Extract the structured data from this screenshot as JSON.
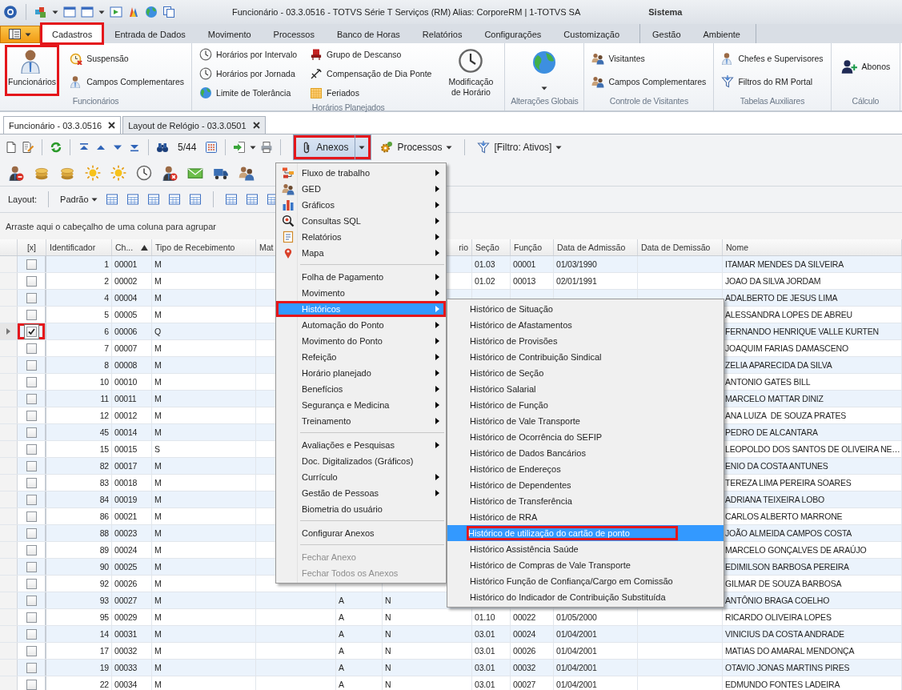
{
  "title_bar": {
    "title": "Funcionário - 03.3.0516 - TOTVS Série T Serviços (RM) Alias: CorporeRM | 1-TOTVS SA",
    "context": "Sistema"
  },
  "ribbon_tabs": [
    {
      "label": "Cadastros",
      "selected": true,
      "highlighted": true
    },
    {
      "label": "Entrada de Dados",
      "selected": false,
      "highlighted": false
    },
    {
      "label": "Movimento",
      "selected": false,
      "highlighted": false
    },
    {
      "label": "Processos",
      "selected": false,
      "highlighted": false
    },
    {
      "label": "Banco de Horas",
      "selected": false,
      "highlighted": false
    },
    {
      "label": "Relatórios",
      "selected": false,
      "highlighted": false
    },
    {
      "label": "Configurações",
      "selected": false,
      "highlighted": false
    },
    {
      "label": "Customização",
      "selected": false,
      "highlighted": false
    }
  ],
  "contextual_tabs": [
    {
      "label": "Gestão",
      "selected": false,
      "highlighted": false
    },
    {
      "label": "Ambiente",
      "selected": false,
      "highlighted": false
    }
  ],
  "ribbon_groups": [
    {
      "label": "Funcionários",
      "items": [
        {
          "kind": "large",
          "label": "Funcionários",
          "highlighted": true
        },
        {
          "kind": "small",
          "label": "Suspensão",
          "highlighted": false
        },
        {
          "kind": "small",
          "label": "Campos Complementares",
          "highlighted": false
        }
      ]
    },
    {
      "label": "Horários Planejados",
      "items": [
        {
          "kind": "small",
          "label": "Horários por Intervalo",
          "highlighted": false
        },
        {
          "kind": "small",
          "label": "Horários por Jornada",
          "highlighted": false
        },
        {
          "kind": "small",
          "label": "Limite de Tolerância",
          "highlighted": false
        },
        {
          "kind": "small",
          "label": "Grupo de Descanso",
          "highlighted": false
        },
        {
          "kind": "small",
          "label": "Compensação de Dia Ponte",
          "highlighted": false
        },
        {
          "kind": "small",
          "label": "Feriados",
          "highlighted": false
        },
        {
          "kind": "large",
          "label": "Modificação de Horário",
          "highlighted": false
        }
      ]
    },
    {
      "label": "Alterações Globais",
      "items": [
        {
          "kind": "dropdown",
          "highlighted": false
        }
      ]
    },
    {
      "label": "Controle de Visitantes",
      "items": [
        {
          "kind": "small",
          "label": "Visitantes",
          "highlighted": false
        },
        {
          "kind": "small",
          "label": "Campos Complementares",
          "highlighted": false
        }
      ]
    },
    {
      "label": "Tabelas Auxiliares",
      "items": [
        {
          "kind": "small",
          "label": "Chefes e Supervisores",
          "highlighted": false
        },
        {
          "kind": "small",
          "label": "Filtros do RM Portal",
          "highlighted": false
        }
      ]
    },
    {
      "label": "Cálculo",
      "items": [
        {
          "kind": "medium",
          "label": "Abonos",
          "highlighted": false
        }
      ]
    }
  ],
  "document_tabs": [
    {
      "label": "Funcionário - 03.3.0516",
      "selected": true
    },
    {
      "label": "Layout de Relógio - 03.3.0501",
      "selected": false
    }
  ],
  "toolbar": {
    "record_position": "5/44",
    "anexos": {
      "label": "Anexos",
      "highlighted": true,
      "expanded": true
    },
    "processos": {
      "label": "Processos"
    },
    "filter": {
      "label": "[Filtro: Ativos]"
    }
  },
  "layout_bar": {
    "label": "Layout:",
    "layout": "Padrão"
  },
  "group_panel": {
    "hint": "Arraste aqui o cabeçalho de uma coluna para agrupar"
  },
  "grid": {
    "check_header": "[x]",
    "columns": [
      {
        "label": "Identificador",
        "kind": "number"
      },
      {
        "label": "Ch...",
        "kind": "text",
        "sorted_ascending": true
      },
      {
        "label": "Tipo de Recebimento",
        "kind": "text"
      },
      {
        "label": "Mat",
        "kind": "text"
      },
      {
        "kind": "text"
      },
      {
        "label": "rio",
        "kind": "cut"
      },
      {
        "label": "Seção",
        "kind": "text"
      },
      {
        "label": "Função",
        "kind": "text"
      },
      {
        "label": "Data de Admissão",
        "kind": "text"
      },
      {
        "label": "Data de Demissão",
        "kind": "text"
      },
      {
        "label": "Nome",
        "kind": "text"
      }
    ],
    "rows": [
      {
        "checked": false,
        "current": false,
        "checkbox_highlighted": false,
        "cells": [
          "1",
          "00001",
          "M",
          null,
          null,
          null,
          "01.03",
          "00001",
          "01/03/1990",
          null,
          "ITAMAR MENDES DA SILVEIRA"
        ]
      },
      {
        "checked": false,
        "current": false,
        "checkbox_highlighted": false,
        "cells": [
          "2",
          "00002",
          "M",
          null,
          null,
          null,
          "01.02",
          "00013",
          "02/01/1991",
          null,
          "JOAO DA SILVA JORDAM"
        ]
      },
      {
        "checked": false,
        "current": false,
        "checkbox_highlighted": false,
        "cells": [
          "4",
          "00004",
          "M",
          null,
          null,
          null,
          null,
          null,
          null,
          null,
          "ADALBERTO DE JESUS LIMA"
        ]
      },
      {
        "checked": false,
        "current": false,
        "checkbox_highlighted": false,
        "cells": [
          "5",
          "00005",
          "M",
          null,
          null,
          null,
          null,
          null,
          null,
          null,
          "ALESSANDRA LOPES DE ABREU"
        ]
      },
      {
        "checked": true,
        "current": true,
        "checkbox_highlighted": true,
        "cells": [
          "6",
          "00006",
          "Q",
          null,
          null,
          null,
          null,
          null,
          null,
          null,
          "FERNANDO HENRIQUE VALLE KURTEN"
        ]
      },
      {
        "checked": false,
        "current": false,
        "checkbox_highlighted": false,
        "cells": [
          "7",
          "00007",
          "M",
          null,
          null,
          null,
          null,
          null,
          null,
          null,
          "JOAQUIM FARIAS DAMASCENO"
        ]
      },
      {
        "checked": false,
        "current": false,
        "checkbox_highlighted": false,
        "cells": [
          "8",
          "00008",
          "M",
          null,
          null,
          null,
          null,
          null,
          null,
          null,
          "ZELIA APARECIDA DA SILVA"
        ]
      },
      {
        "checked": false,
        "current": false,
        "checkbox_highlighted": false,
        "cells": [
          "10",
          "00010",
          "M",
          null,
          null,
          null,
          null,
          null,
          null,
          null,
          "ANTONIO GATES BILL"
        ]
      },
      {
        "checked": false,
        "current": false,
        "checkbox_highlighted": false,
        "cells": [
          "11",
          "00011",
          "M",
          null,
          null,
          null,
          null,
          null,
          null,
          null,
          "MARCELO MATTAR DINIZ"
        ]
      },
      {
        "checked": false,
        "current": false,
        "checkbox_highlighted": false,
        "cells": [
          "12",
          "00012",
          "M",
          null,
          null,
          null,
          null,
          null,
          null,
          null,
          "ANA LUIZA  DE SOUZA PRATES"
        ]
      },
      {
        "checked": false,
        "current": false,
        "checkbox_highlighted": false,
        "cells": [
          "45",
          "00014",
          "M",
          null,
          null,
          null,
          null,
          null,
          null,
          null,
          "PEDRO DE ALCANTARA"
        ]
      },
      {
        "checked": false,
        "current": false,
        "checkbox_highlighted": false,
        "cells": [
          "15",
          "00015",
          "S",
          null,
          null,
          null,
          null,
          null,
          null,
          null,
          "LEOPOLDO DOS SANTOS DE OLIVEIRA NE…"
        ]
      },
      {
        "checked": false,
        "current": false,
        "checkbox_highlighted": false,
        "cells": [
          "82",
          "00017",
          "M",
          null,
          null,
          null,
          null,
          null,
          null,
          null,
          "ENIO DA COSTA ANTUNES"
        ]
      },
      {
        "checked": false,
        "current": false,
        "checkbox_highlighted": false,
        "cells": [
          "83",
          "00018",
          "M",
          null,
          null,
          null,
          null,
          null,
          null,
          null,
          "TEREZA LIMA PEREIRA SOARES"
        ]
      },
      {
        "checked": false,
        "current": false,
        "checkbox_highlighted": false,
        "cells": [
          "84",
          "00019",
          "M",
          null,
          null,
          null,
          null,
          null,
          null,
          null,
          "ADRIANA TEIXEIRA LOBO"
        ]
      },
      {
        "checked": false,
        "current": false,
        "checkbox_highlighted": false,
        "cells": [
          "86",
          "00021",
          "M",
          null,
          null,
          null,
          null,
          null,
          null,
          null,
          "CARLOS ALBERTO MARRONE"
        ]
      },
      {
        "checked": false,
        "current": false,
        "checkbox_highlighted": false,
        "cells": [
          "88",
          "00023",
          "M",
          null,
          null,
          null,
          null,
          null,
          null,
          null,
          "JOÃO ALMEIDA CAMPOS COSTA"
        ]
      },
      {
        "checked": false,
        "current": false,
        "checkbox_highlighted": false,
        "cells": [
          "89",
          "00024",
          "M",
          null,
          null,
          null,
          null,
          null,
          null,
          null,
          "MARCELO GONÇALVES DE ARAÚJO"
        ]
      },
      {
        "checked": false,
        "current": false,
        "checkbox_highlighted": false,
        "cells": [
          "90",
          "00025",
          "M",
          null,
          null,
          null,
          null,
          null,
          null,
          null,
          "EDIMILSON BARBOSA PEREIRA"
        ]
      },
      {
        "checked": false,
        "current": false,
        "checkbox_highlighted": false,
        "cells": [
          "92",
          "00026",
          "M",
          null,
          null,
          null,
          null,
          null,
          null,
          null,
          "GILMAR DE SOUZA BARBOSA"
        ]
      },
      {
        "checked": false,
        "current": false,
        "checkbox_highlighted": false,
        "cells": [
          "93",
          "00027",
          "M",
          null,
          "A",
          "N",
          null,
          null,
          null,
          null,
          "ANTÔNIO BRAGA COELHO"
        ]
      },
      {
        "checked": false,
        "current": false,
        "checkbox_highlighted": false,
        "cells": [
          "95",
          "00029",
          "M",
          null,
          "A",
          "N",
          "01.10",
          "00022",
          "01/05/2000",
          null,
          "RICARDO OLIVEIRA LOPES"
        ]
      },
      {
        "checked": false,
        "current": false,
        "checkbox_highlighted": false,
        "cells": [
          "14",
          "00031",
          "M",
          null,
          "A",
          "N",
          "03.01",
          "00024",
          "01/04/2001",
          null,
          "VINICIUS DA COSTA ANDRADE"
        ]
      },
      {
        "checked": false,
        "current": false,
        "checkbox_highlighted": false,
        "cells": [
          "17",
          "00032",
          "M",
          null,
          "A",
          "N",
          "03.01",
          "00026",
          "01/04/2001",
          null,
          "MATIAS DO AMARAL MENDONÇA"
        ]
      },
      {
        "checked": false,
        "current": false,
        "checkbox_highlighted": false,
        "cells": [
          "19",
          "00033",
          "M",
          null,
          "A",
          "N",
          "03.01",
          "00032",
          "01/04/2001",
          null,
          "OTAVIO JONAS MARTINS PIRES"
        ]
      },
      {
        "checked": false,
        "current": false,
        "checkbox_highlighted": false,
        "cells": [
          "22",
          "00034",
          "M",
          null,
          "A",
          "N",
          "03.01",
          "00027",
          "01/04/2001",
          null,
          "EDMUNDO FONTES LADEIRA"
        ]
      }
    ]
  },
  "anexos_menu": {
    "groups": [
      [
        {
          "label": "Fluxo de trabalho",
          "submenu": true,
          "selected": false,
          "highlighted": false,
          "disabled": false
        },
        {
          "label": "GED",
          "submenu": true,
          "selected": false,
          "highlighted": false,
          "disabled": false
        },
        {
          "label": "Gráficos",
          "submenu": true,
          "selected": false,
          "highlighted": false,
          "disabled": false
        },
        {
          "label": "Consultas SQL",
          "submenu": true,
          "selected": false,
          "highlighted": false,
          "disabled": false
        },
        {
          "label": "Relatórios",
          "submenu": true,
          "selected": false,
          "highlighted": false,
          "disabled": false
        },
        {
          "label": "Mapa",
          "submenu": true,
          "selected": false,
          "highlighted": false,
          "disabled": false
        }
      ],
      [
        {
          "label": "Folha de Pagamento",
          "submenu": true,
          "selected": false,
          "highlighted": false,
          "disabled": false
        },
        {
          "label": "Movimento",
          "submenu": true,
          "selected": false,
          "highlighted": false,
          "disabled": false
        },
        {
          "label": "Históricos",
          "submenu": true,
          "selected": true,
          "highlighted": true,
          "disabled": false
        },
        {
          "label": "Automação do Ponto",
          "submenu": true,
          "selected": false,
          "highlighted": false,
          "disabled": false
        },
        {
          "label": "Movimento do Ponto",
          "submenu": true,
          "selected": false,
          "highlighted": false,
          "disabled": false
        },
        {
          "label": "Refeição",
          "submenu": true,
          "selected": false,
          "highlighted": false,
          "disabled": false
        },
        {
          "label": "Horário planejado",
          "submenu": true,
          "selected": false,
          "highlighted": false,
          "disabled": false
        },
        {
          "label": "Benefícios",
          "submenu": true,
          "selected": false,
          "highlighted": false,
          "disabled": false
        },
        {
          "label": "Segurança e Medicina",
          "submenu": true,
          "selected": false,
          "highlighted": false,
          "disabled": false
        },
        {
          "label": "Treinamento",
          "submenu": true,
          "selected": false,
          "highlighted": false,
          "disabled": false
        }
      ],
      [
        {
          "label": "Avaliações e Pesquisas",
          "submenu": true,
          "selected": false,
          "highlighted": false,
          "disabled": false
        },
        {
          "label": "Doc. Digitalizados (Gráficos)",
          "submenu": false,
          "selected": false,
          "highlighted": false,
          "disabled": false
        },
        {
          "label": "Currículo",
          "submenu": true,
          "selected": false,
          "highlighted": false,
          "disabled": false
        },
        {
          "label": "Gestão de Pessoas",
          "submenu": true,
          "selected": false,
          "highlighted": false,
          "disabled": false
        },
        {
          "label": "Biometria do usuário",
          "submenu": false,
          "selected": false,
          "highlighted": false,
          "disabled": false
        }
      ],
      [
        {
          "label": "Configurar Anexos",
          "submenu": false,
          "selected": false,
          "highlighted": false,
          "disabled": false
        }
      ],
      [
        {
          "label": "Fechar Anexo",
          "submenu": false,
          "selected": false,
          "highlighted": false,
          "disabled": true
        },
        {
          "label": "Fechar Todos os Anexos",
          "submenu": false,
          "selected": false,
          "highlighted": false,
          "disabled": true
        }
      ]
    ]
  },
  "historicos_submenu": {
    "items": [
      {
        "label": "Histórico de Situação",
        "selected": false,
        "highlighted": false
      },
      {
        "label": "Histórico de Afastamentos",
        "selected": false,
        "highlighted": false
      },
      {
        "label": "Histórico de Provisões",
        "selected": false,
        "highlighted": false
      },
      {
        "label": "Histórico de Contribuição Sindical",
        "selected": false,
        "highlighted": false
      },
      {
        "label": "Histórico de Seção",
        "selected": false,
        "highlighted": false
      },
      {
        "label": "Histórico Salarial",
        "selected": false,
        "highlighted": false
      },
      {
        "label": "Histórico de Função",
        "selected": false,
        "highlighted": false
      },
      {
        "label": "Histórico de Vale Transporte",
        "selected": false,
        "highlighted": false
      },
      {
        "label": "Histórico de Ocorrência do SEFIP",
        "selected": false,
        "highlighted": false
      },
      {
        "label": "Histórico de Dados Bancários",
        "selected": false,
        "highlighted": false
      },
      {
        "label": "Histórico de Endereços",
        "selected": false,
        "highlighted": false
      },
      {
        "label": "Histórico de Dependentes",
        "selected": false,
        "highlighted": false
      },
      {
        "label": "Histórico de Transferência",
        "selected": false,
        "highlighted": false
      },
      {
        "label": "Histórico de RRA",
        "selected": false,
        "highlighted": false
      },
      {
        "label": "Histórico de utilização do cartão de ponto",
        "selected": true,
        "highlighted": true
      },
      {
        "label": "Histórico Assistência Saúde",
        "selected": false,
        "highlighted": false
      },
      {
        "label": "Histórico de Compras de Vale Transporte",
        "selected": false,
        "highlighted": false
      },
      {
        "label": "Histórico Função de Confiança/Cargo em Comissão",
        "selected": false,
        "highlighted": false
      },
      {
        "label": "Histórico do Indicador de Contribuição Substituída",
        "selected": false,
        "highlighted": false
      }
    ]
  }
}
